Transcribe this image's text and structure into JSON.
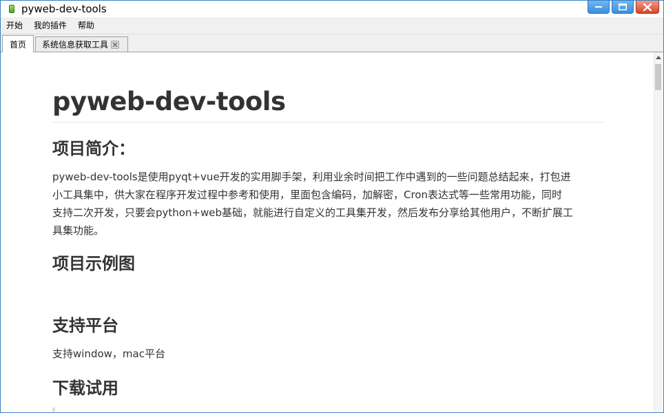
{
  "window": {
    "title": "pyweb-dev-tools"
  },
  "menubar": {
    "items": [
      "开始",
      "我的插件",
      "帮助"
    ]
  },
  "tabs": [
    {
      "label": "首页",
      "active": true
    },
    {
      "label": "系统信息获取工具",
      "active": false,
      "closable": true
    }
  ],
  "article": {
    "title": "pyweb-dev-tools",
    "sections": [
      {
        "heading": "项目简介："
      },
      {
        "heading": "项目示例图"
      },
      {
        "heading": "支持平台"
      },
      {
        "heading": "下载试用"
      }
    ],
    "intro_lines": [
      "pyweb-dev-tools是使用pyqt+vue开发的实用脚手架，利用业余时间把工作中遇到的一些问题总结起来，打包进",
      "小工具集中，供大家在程序开发过程中参考和使用，里面包含编码，加解密，Cron表达式等一些常用功能，同时",
      "支持二次开发，只要会python+web基础，就能进行自定义的工具集开发，然后发布分享给其他用户，不断扩展工",
      "具集功能。"
    ],
    "platform_text": "支持window，mac平台"
  },
  "icons": {
    "app": "app-icon",
    "minimize": "minimize-icon",
    "maximize": "maximize-icon",
    "close": "close-icon",
    "tab_close": "tab-close-icon"
  },
  "colors": {
    "close_red": "#d9442b",
    "titlebar_blue": "#3b8fdb",
    "text": "#333333"
  }
}
